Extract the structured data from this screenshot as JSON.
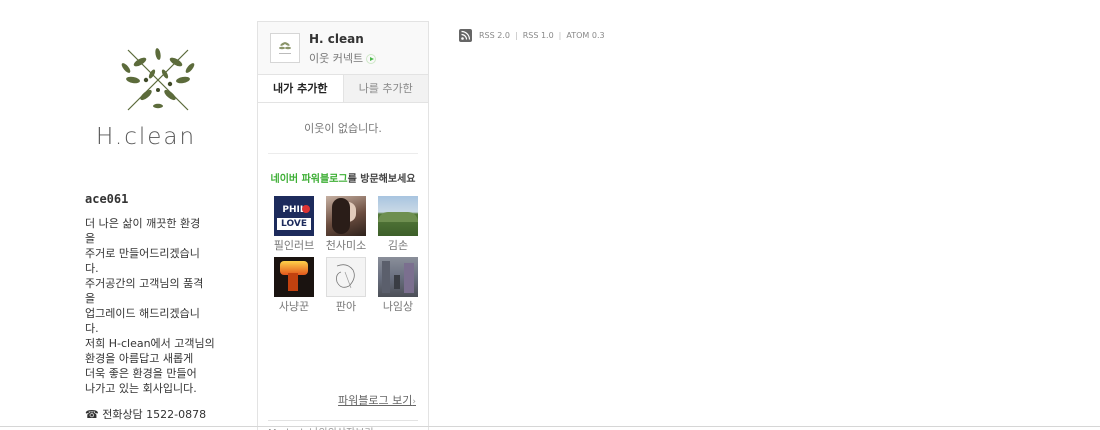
{
  "profile": {
    "logo_text": "H.clean",
    "blog_id": "ace061",
    "intro": "더 나은 삶이 깨끗한 환경\n을\n주거로 만들어드리겠습니\n다.\n주거공간의 고객님의 품격\n을\n업그레이드 해드리겠습니\n다.\n저희 H-clean에서 고객님의\n환경을 아름답고 새롭게\n더욱 좋은 환경을 만들어\n나가고 있는 회사입니다.",
    "phone_label": "☎ 전화상담 1522-0878"
  },
  "neighbor_widget": {
    "title": "H. clean",
    "connect_label": "이웃 커넥트",
    "tabs": [
      "내가 추가한",
      "나를 추가한"
    ],
    "empty_message": "이웃이 없습니다.",
    "powerblog_title_green": "네이버 파워블로그",
    "powerblog_title_rest": "를 방문해보세요",
    "powerblogs": [
      {
        "name": "필인러브",
        "icon": "phil-love-logo"
      },
      {
        "name": "천사미소",
        "icon": "portrait-photo"
      },
      {
        "name": "김손",
        "icon": "landscape-photo"
      },
      {
        "name": "사냥꾼",
        "icon": "fire-photo"
      },
      {
        "name": "판아",
        "icon": "sketch-drawing"
      },
      {
        "name": "나임상",
        "icon": "street-photo"
      }
    ],
    "more_link": "파워블로그 보기",
    "footer_text": "Mydesk 나의의상장보기"
  },
  "rss": {
    "links": [
      "RSS 2.0",
      "RSS 1.0",
      "ATOM 0.3"
    ],
    "separator": "|"
  },
  "colors": {
    "accent_green": "#3eaf36",
    "border": "#e3e3e3",
    "text": "#333333"
  }
}
